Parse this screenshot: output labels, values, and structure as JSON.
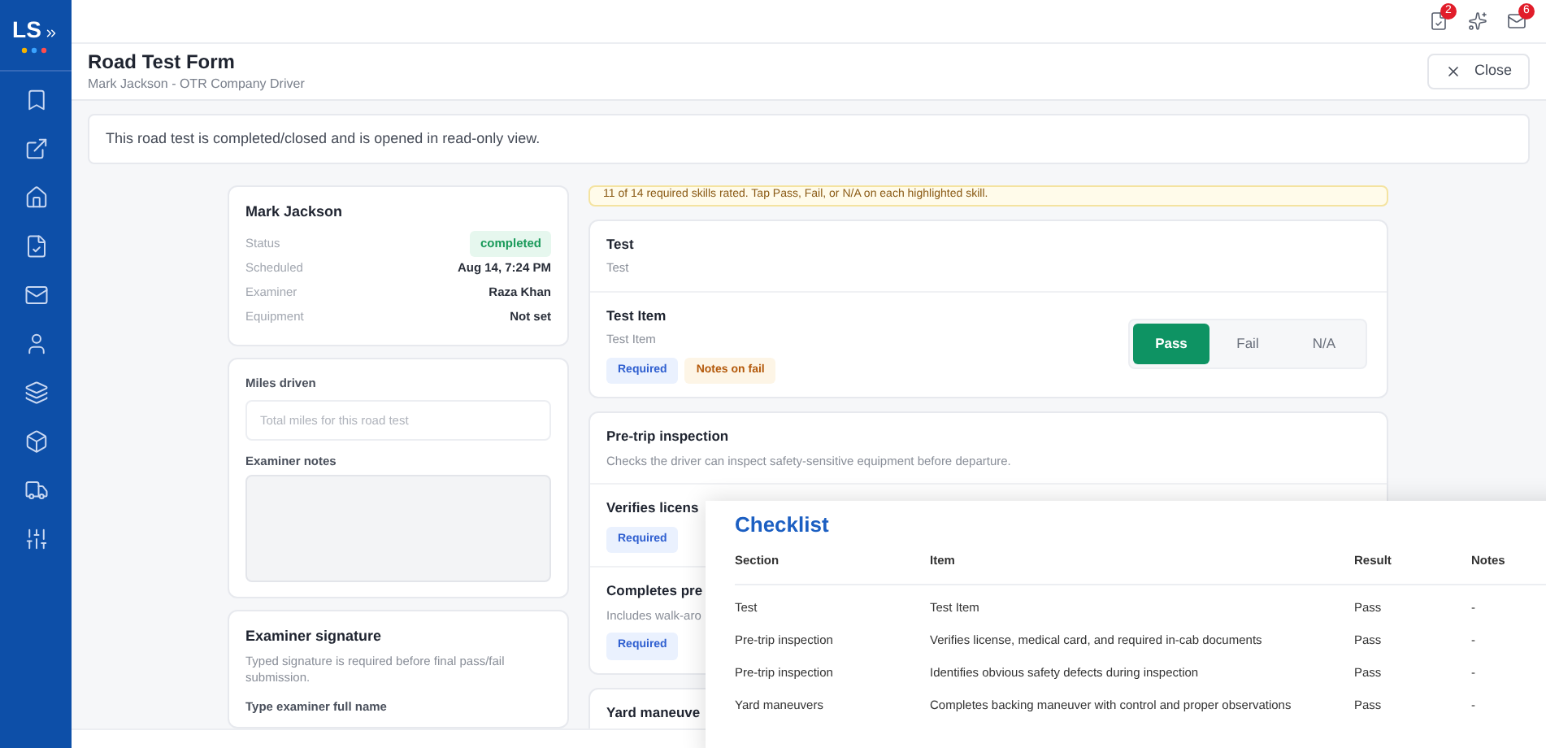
{
  "sidebar": {
    "logo": "LS"
  },
  "topbar": {
    "badges": [
      "2",
      "6"
    ]
  },
  "header": {
    "title": "Road Test Form",
    "subtitle": "Mark Jackson - OTR Company Driver",
    "close": "Close"
  },
  "notice": "This road test is completed/closed and is opened in read-only view.",
  "summary": {
    "name": "Mark Jackson",
    "fields": [
      {
        "label": "Status",
        "value": "completed",
        "kind": "badge"
      },
      {
        "label": "Scheduled",
        "value": "Aug 14, 7:24 PM",
        "kind": "text"
      },
      {
        "label": "Examiner",
        "value": "Raza Khan",
        "kind": "text"
      },
      {
        "label": "Equipment",
        "value": "Not set",
        "kind": "text"
      }
    ]
  },
  "miles": {
    "label": "Miles driven",
    "placeholder": "Total miles for this road test"
  },
  "notes": {
    "label": "Examiner notes"
  },
  "signature": {
    "title": "Examiner signature",
    "hint": "Typed signature is required before final pass/fail submission.",
    "field_label": "Type examiner full name"
  },
  "progress_banner": "11 of 14 required skills rated. Tap Pass, Fail, or N/A on each highlighted skill.",
  "sections": [
    {
      "title": "Test",
      "description": "Test",
      "items": [
        {
          "title": "Test Item",
          "description": "Test Item",
          "tags": [
            {
              "label": "Required",
              "kind": "required"
            },
            {
              "label": "Notes on fail",
              "kind": "notes"
            }
          ],
          "rating": [
            {
              "label": "Pass",
              "selected": true
            },
            {
              "label": "Fail",
              "selected": false
            },
            {
              "label": "N/A",
              "selected": false
            }
          ]
        }
      ]
    },
    {
      "title": "Pre-trip inspection",
      "description": "Checks the driver can inspect safety-sensitive equipment before departure.",
      "items": [
        {
          "title": "Verifies licens",
          "tags": [
            {
              "label": "Required",
              "kind": "required"
            }
          ]
        },
        {
          "title": "Completes pre",
          "description": "Includes walk-aro",
          "tags": [
            {
              "label": "Required",
              "kind": "required"
            }
          ]
        }
      ]
    },
    {
      "title": "Yard maneuve"
    }
  ],
  "checklist": {
    "title": "Checklist",
    "columns": [
      "Section",
      "Item",
      "Result",
      "Notes"
    ],
    "rows": [
      [
        "Test",
        "Test Item",
        "Pass",
        "-"
      ],
      [
        "Pre-trip inspection",
        "Verifies license, medical card, and required in-cab documents",
        "Pass",
        "-"
      ],
      [
        "Pre-trip inspection",
        "Identifies obvious safety defects during inspection",
        "Pass",
        "-"
      ],
      [
        "Yard maneuvers",
        "Completes backing maneuver with control and proper observations",
        "Pass",
        "-"
      ]
    ]
  }
}
